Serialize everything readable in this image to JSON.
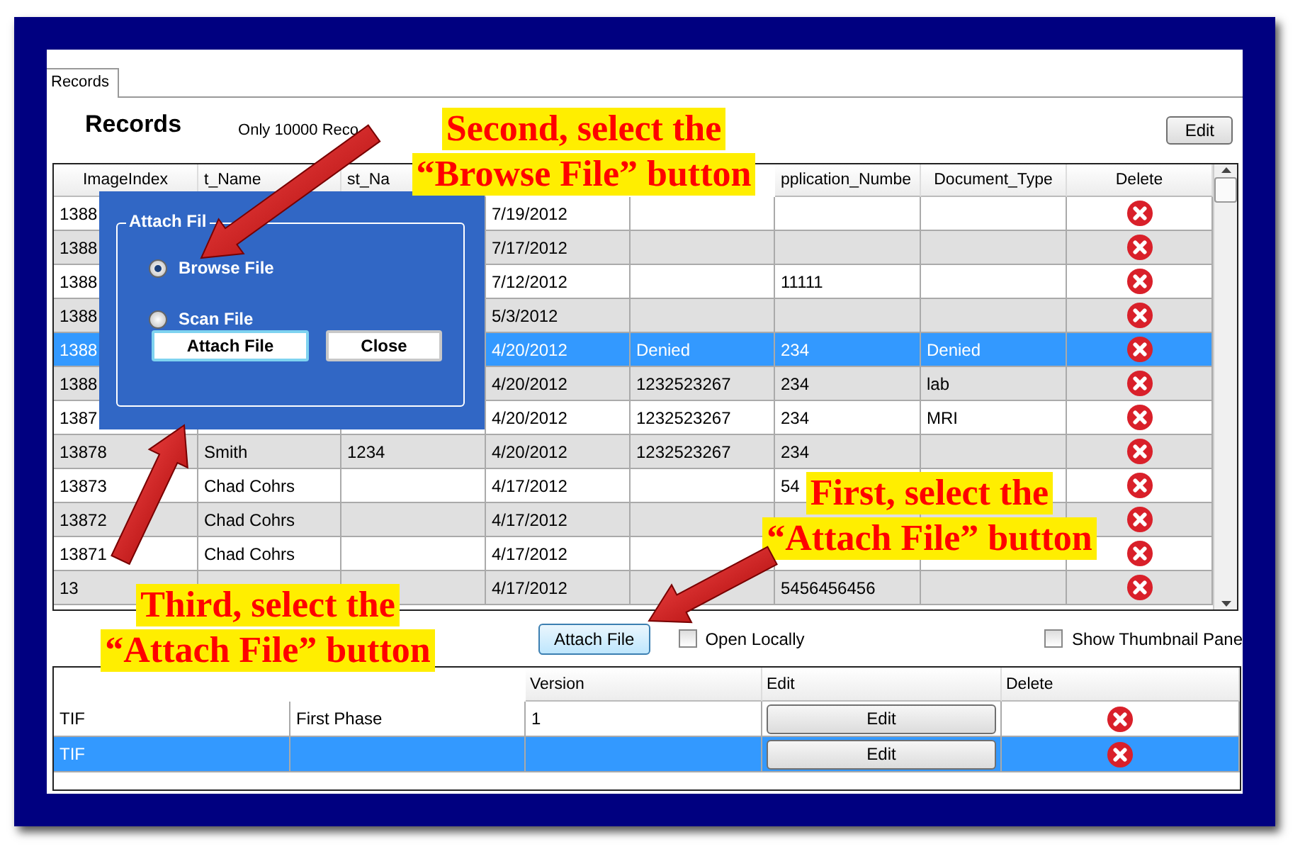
{
  "tabs": [
    {
      "label": "Records",
      "selected": true
    }
  ],
  "header": {
    "title": "Records",
    "note": "Only 10000 Reco",
    "edit_button": "Edit"
  },
  "records_table": {
    "columns": [
      {
        "label": "ImageIndex"
      },
      {
        "label": "t_Name"
      },
      {
        "label": "st_Na"
      },
      {},
      {},
      {
        "label": "pplication_Numbe"
      },
      {
        "label": "Document_Type"
      },
      {
        "label": "Delete"
      }
    ],
    "rows": [
      {
        "image_index": "1388",
        "col_4": "7/19/2012",
        "selected": false
      },
      {
        "image_index": "1388",
        "col_4": "7/17/2012",
        "selected": false
      },
      {
        "image_index": "1388",
        "col_4": "7/12/2012",
        "application_number": "11111",
        "selected": false
      },
      {
        "image_index": "1388",
        "col_4": "5/3/2012",
        "selected": false
      },
      {
        "image_index": "1388",
        "col_4": "4/20/2012",
        "col_5": "Denied",
        "application_number": "234",
        "document_type": "Denied",
        "selected": true
      },
      {
        "image_index": "1388",
        "col_4": "4/20/2012",
        "col_5": "1232523267",
        "application_number": "234",
        "document_type": "lab",
        "selected": false
      },
      {
        "image_index": "1387",
        "col_4": "4/20/2012",
        "col_5": "1232523267",
        "application_number": "234",
        "document_type": "MRI",
        "selected": false
      },
      {
        "image_index": "13878",
        "name": "Smith",
        "col_3": "1234",
        "col_4": "4/20/2012",
        "col_5": "1232523267",
        "application_number": "234",
        "selected": false
      },
      {
        "image_index": "13873",
        "name": "Chad Cohrs",
        "col_4": "4/17/2012",
        "application_number": "54",
        "selected": false
      },
      {
        "image_index": "13872",
        "name": "Chad Cohrs",
        "col_4": "4/17/2012",
        "selected": false
      },
      {
        "image_index": "13871",
        "name": "Chad Cohrs",
        "col_4": "4/17/2012",
        "selected": false
      },
      {
        "image_index": "13",
        "col_4": "4/17/2012",
        "application_number": "5456456456",
        "selected": false
      }
    ]
  },
  "actions": {
    "attach_button": "Attach File",
    "options": [
      {
        "label": "Open Locally",
        "checked": false
      },
      {
        "label": "Show Thumbnail Pane",
        "checked": false
      }
    ]
  },
  "files_table": {
    "columns": [
      {},
      {},
      {
        "label": "Version"
      },
      {
        "label": "Edit"
      },
      {
        "label": "Delete"
      }
    ],
    "rows": [
      {
        "file_type": "TIF",
        "description": "First Phase",
        "version": "1",
        "edit_button": "Edit",
        "selected": false
      },
      {
        "file_type": "TIF",
        "edit_button": "Edit",
        "selected": true
      }
    ]
  },
  "dialog": {
    "group_title": "Attach Fil",
    "options": [
      {
        "label": "Browse File",
        "selected": true
      },
      {
        "label": "Scan File",
        "selected": false
      }
    ],
    "buttons": [
      "Attach File",
      "Close"
    ]
  },
  "callouts": [
    {
      "lines": [
        "Second, select the",
        "“Browse File” button"
      ]
    },
    {
      "lines": [
        "First, select the",
        "“Attach File” button"
      ]
    },
    {
      "lines": [
        "Third, select the",
        "“Attach File” button"
      ]
    }
  ]
}
